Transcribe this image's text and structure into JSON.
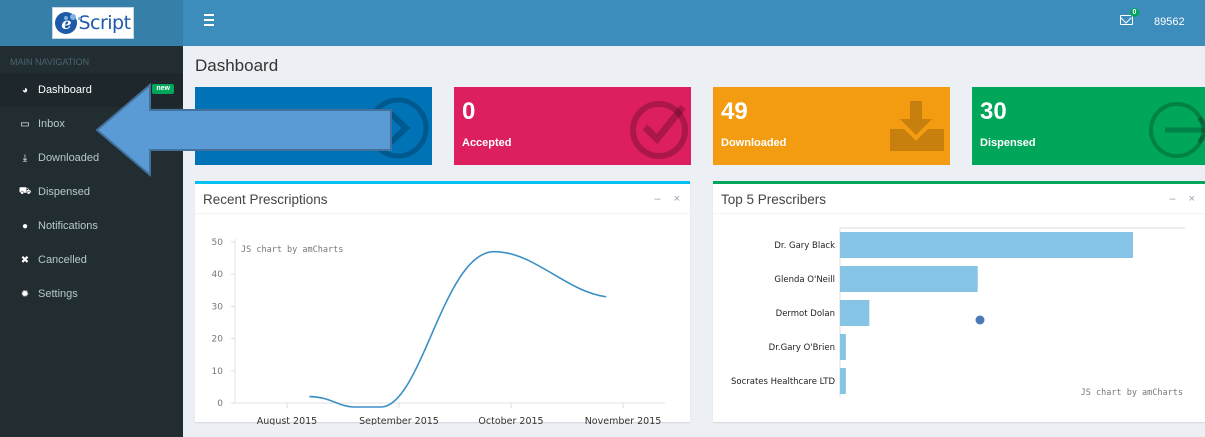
{
  "header": {
    "logo_letter": "e",
    "logo_word": "Script",
    "mail_count": "0",
    "user_id": "89562"
  },
  "sidebar": {
    "header": "MAIN NAVIGATION",
    "items": [
      {
        "label": "Dashboard",
        "icon": "dashboard-icon",
        "badge": "new"
      },
      {
        "label": "Inbox",
        "icon": "inbox-icon"
      },
      {
        "label": "Downloaded",
        "icon": "download-icon"
      },
      {
        "label": "Dispensed",
        "icon": "cart-icon"
      },
      {
        "label": "Notifications",
        "icon": "comment-icon"
      },
      {
        "label": "Cancelled",
        "icon": "times-icon"
      },
      {
        "label": "Settings",
        "icon": "gear-icon"
      }
    ]
  },
  "page": {
    "title": "Dashboard"
  },
  "info_boxes": [
    {
      "value": "",
      "label": "",
      "color": "#0073b7",
      "icon": "arrow-circle-icon"
    },
    {
      "value": "0",
      "label": "Accepted",
      "color": "#dd1e5f",
      "icon": "check-circle-icon"
    },
    {
      "value": "49",
      "label": "Downloaded",
      "color": "#f39c12",
      "icon": "download-tray-icon"
    },
    {
      "value": "30",
      "label": "Dispensed",
      "color": "#00a65a",
      "icon": "sign-out-icon"
    }
  ],
  "recent_panel": {
    "title": "Recent Prescriptions",
    "minimize": "–",
    "close": "×",
    "credit": "JS chart by amCharts",
    "accent": "#00c0ef"
  },
  "top_panel": {
    "title": "Top 5 Prescribers",
    "minimize": "–",
    "close": "×",
    "credit": "JS chart by amCharts",
    "accent": "#00a65a"
  },
  "chart_data": [
    {
      "type": "line",
      "title": "Recent Prescriptions",
      "categories": [
        "August 2015",
        "September 2015",
        "October 2015",
        "November 2015"
      ],
      "x_values": [
        0,
        1,
        2,
        3
      ],
      "series": [
        {
          "values": [
            2,
            0,
            47,
            33
          ],
          "x": [
            0.2,
            0.85,
            1.85,
            2.85
          ],
          "color": "#3a8fc5"
        }
      ],
      "y_ticks": [
        0,
        10,
        20,
        30,
        40,
        50
      ],
      "ylim": [
        0,
        50
      ],
      "grid": false
    },
    {
      "type": "bar",
      "orientation": "horizontal",
      "title": "Top 5 Prescribers",
      "categories": [
        "Dr. Gary Black",
        "Glenda O'Neill",
        "Dermot Dolan",
        "Dr.Gary O'Brien",
        "Socrates Healthcare LTD"
      ],
      "values": [
        100,
        47,
        10,
        2,
        2
      ],
      "color": "#85c4e4",
      "grid": false
    }
  ]
}
